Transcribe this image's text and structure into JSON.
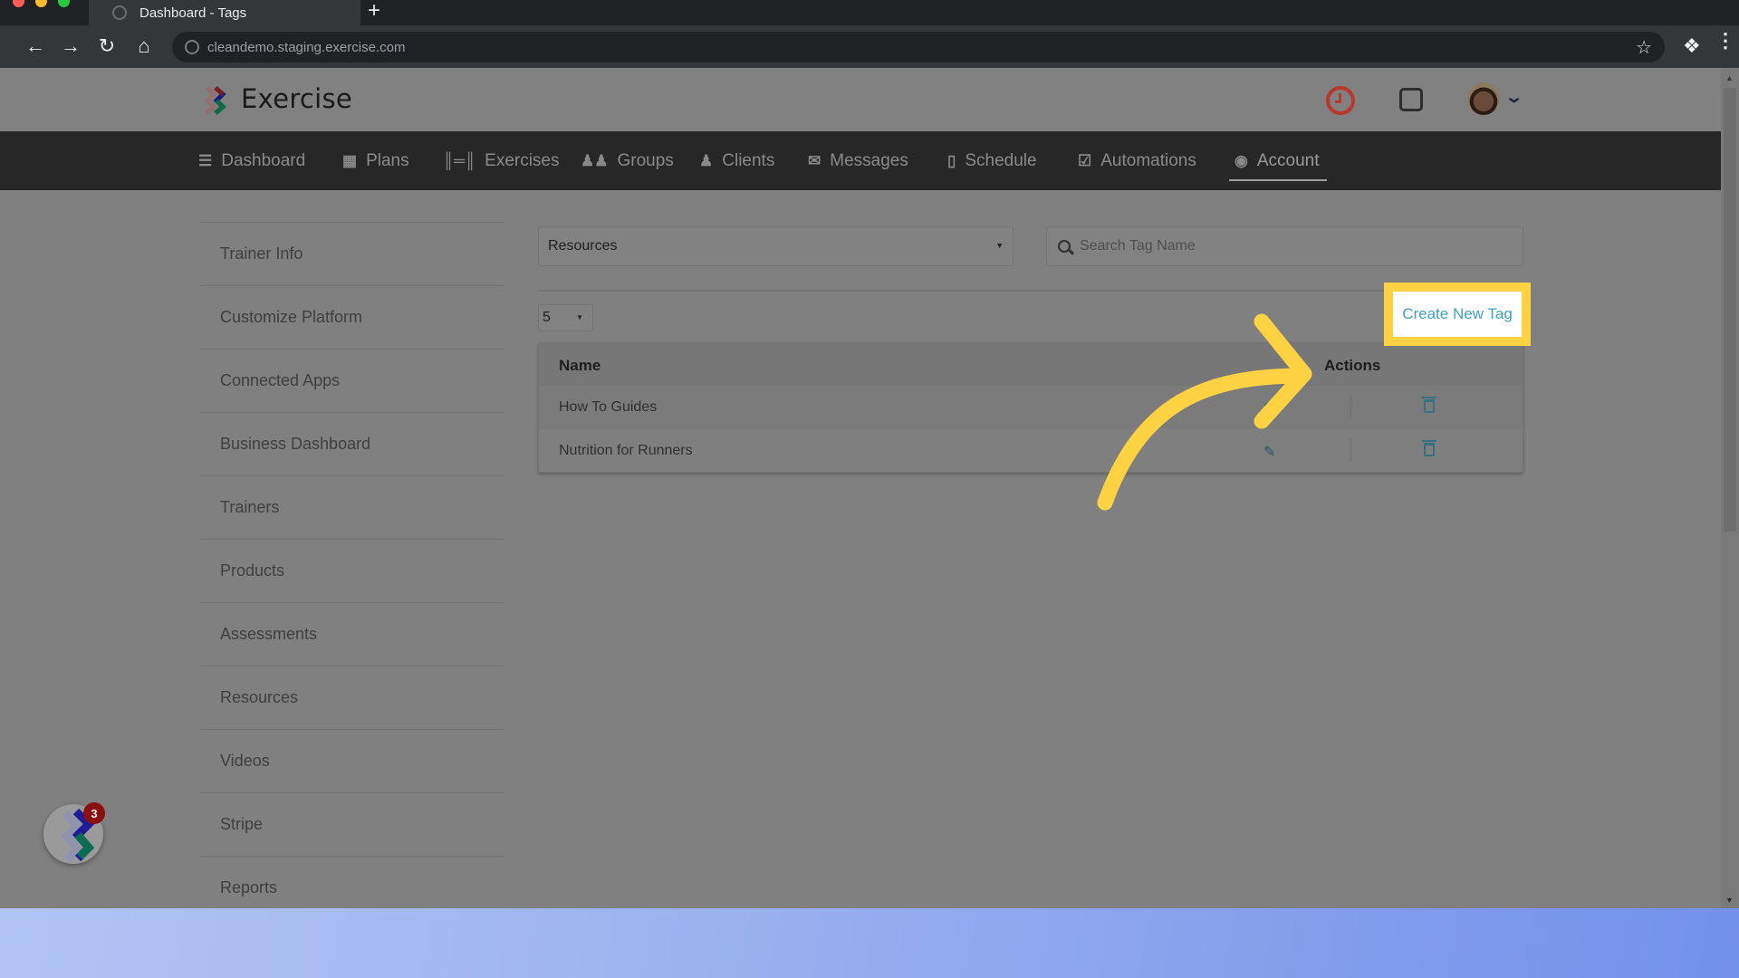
{
  "browser": {
    "tab_title": "Dashboard - Tags",
    "new_tab_label": "+",
    "url": "cleandemo.staging.exercise.com",
    "icons": [
      "back-icon",
      "forward-icon",
      "reload-icon",
      "home-icon",
      "bookmark-star-icon",
      "extensions-icon",
      "menu-icon"
    ]
  },
  "header": {
    "brand": "Exercise",
    "icons": [
      "clock-icon",
      "square-icon",
      "avatar",
      "chevron-down-icon"
    ]
  },
  "nav": {
    "items": [
      {
        "label": "Dashboard",
        "icon": "list-icon"
      },
      {
        "label": "Plans",
        "icon": "clipboard-icon"
      },
      {
        "label": "Exercises",
        "icon": "dumbbell-icon"
      },
      {
        "label": "Groups",
        "icon": "users-icon"
      },
      {
        "label": "Clients",
        "icon": "user-icon"
      },
      {
        "label": "Messages",
        "icon": "envelope-icon"
      },
      {
        "label": "Schedule",
        "icon": "book-icon"
      },
      {
        "label": "Automations",
        "icon": "checkbox-icon"
      },
      {
        "label": "Account",
        "icon": "user-circle-icon",
        "active": true
      }
    ]
  },
  "sidebar": {
    "items": [
      {
        "label": "Trainer Info"
      },
      {
        "label": "Customize Platform"
      },
      {
        "label": "Connected Apps"
      },
      {
        "label": "Business Dashboard"
      },
      {
        "label": "Trainers"
      },
      {
        "label": "Products"
      },
      {
        "label": "Assessments"
      },
      {
        "label": "Resources"
      },
      {
        "label": "Videos"
      },
      {
        "label": "Stripe"
      },
      {
        "label": "Reports"
      }
    ]
  },
  "filters": {
    "category_selected": "Resources",
    "search_placeholder": "Search Tag Name",
    "search_value": "",
    "page_size": "5"
  },
  "actions": {
    "create_label": "Create New Tag"
  },
  "table": {
    "columns": [
      "Name",
      "Actions"
    ],
    "rows": [
      {
        "name": "How To Guides"
      },
      {
        "name": "Nutrition for Runners"
      }
    ]
  },
  "chat": {
    "badge_count": "3"
  },
  "colors": {
    "highlight": "#ffd244",
    "link": "#3fa2c3",
    "alert": "#b9372b"
  }
}
